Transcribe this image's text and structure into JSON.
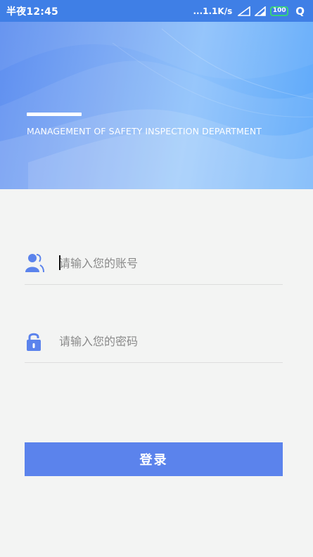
{
  "status_bar": {
    "time": "半夜12:45",
    "net_speed": "...1.1K/s",
    "battery": "100",
    "extra_glyph": "Q",
    "icons": [
      "signal-icon",
      "signal-icon",
      "battery-icon"
    ]
  },
  "hero": {
    "subtitle": "MANAGEMENT OF SAFETY INSPECTION DEPARTMENT"
  },
  "login_form": {
    "account": {
      "placeholder": "请输入您的账号",
      "value": "",
      "icon": "user-icon"
    },
    "password": {
      "placeholder": "请输入您的密码",
      "value": "",
      "icon": "lock-icon"
    },
    "submit_label": "登录"
  },
  "colors": {
    "status_bar": "#3f7fe6",
    "accent": "#5b83ec",
    "background": "#f3f4f3",
    "battery": "#37d27a"
  }
}
